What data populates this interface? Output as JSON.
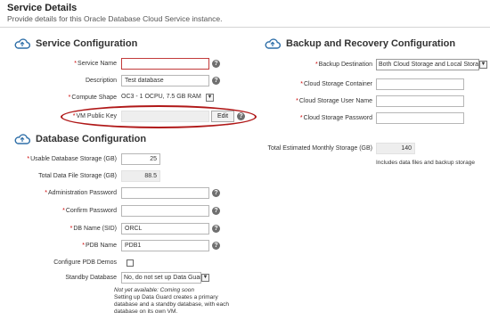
{
  "header": {
    "title": "Service Details",
    "subtitle": "Provide details for this Oracle Database Cloud Service instance."
  },
  "service_config": {
    "title": "Service Configuration",
    "icon": "cloud-icon",
    "service_name": {
      "label": "Service Name",
      "value": ""
    },
    "description": {
      "label": "Description",
      "value": "Test database"
    },
    "compute_shape": {
      "label": "Compute Shape",
      "value": "OC3 - 1 OCPU, 7.5 GB RAM"
    },
    "vm_public_key": {
      "label": "VM Public Key",
      "value": "",
      "edit_label": "Edit"
    }
  },
  "database_config": {
    "title": "Database Configuration",
    "icon": "cloud-icon",
    "usable_storage": {
      "label": "Usable Database Storage (GB)",
      "value": "25"
    },
    "total_storage": {
      "label": "Total Data File Storage (GB)",
      "value": "88.5"
    },
    "admin_password": {
      "label": "Administration Password",
      "value": ""
    },
    "confirm_password": {
      "label": "Confirm Password",
      "value": ""
    },
    "db_name": {
      "label": "DB Name (SID)",
      "value": "ORCL"
    },
    "pdb_name": {
      "label": "PDB Name",
      "value": "PDB1"
    },
    "configure_pdb_demos": {
      "label": "Configure PDB Demos",
      "checked": false
    },
    "standby_database": {
      "label": "Standby Database",
      "value": "No, do not set up Data Guard"
    },
    "note_line1": "Not yet available: Coming soon",
    "note_line2": "Setting up Data Guard creates a primary",
    "note_line3": "database and a standby database, with each",
    "note_line4": "database on its own VM."
  },
  "backup_config": {
    "title": "Backup and Recovery Configuration",
    "icon": "cloud-icon",
    "backup_destination": {
      "label": "Backup Destination",
      "value": "Both Cloud Storage and Local Storage"
    },
    "storage_container": {
      "label": "Cloud Storage Container",
      "value": ""
    },
    "storage_user": {
      "label": "Cloud Storage User Name",
      "value": ""
    },
    "storage_password": {
      "label": "Cloud Storage Password",
      "value": ""
    },
    "total_monthly": {
      "label": "Total Estimated Monthly Storage (GB)",
      "value": "140"
    },
    "total_monthly_note": "Includes data files and backup storage"
  },
  "colors": {
    "required_marker": "#cc0000",
    "annotation_ellipse": "#b01818",
    "help_icon": "#6f6f6f"
  },
  "req_marker": "*",
  "help_glyph": "?",
  "dropdown_glyph": "▼"
}
